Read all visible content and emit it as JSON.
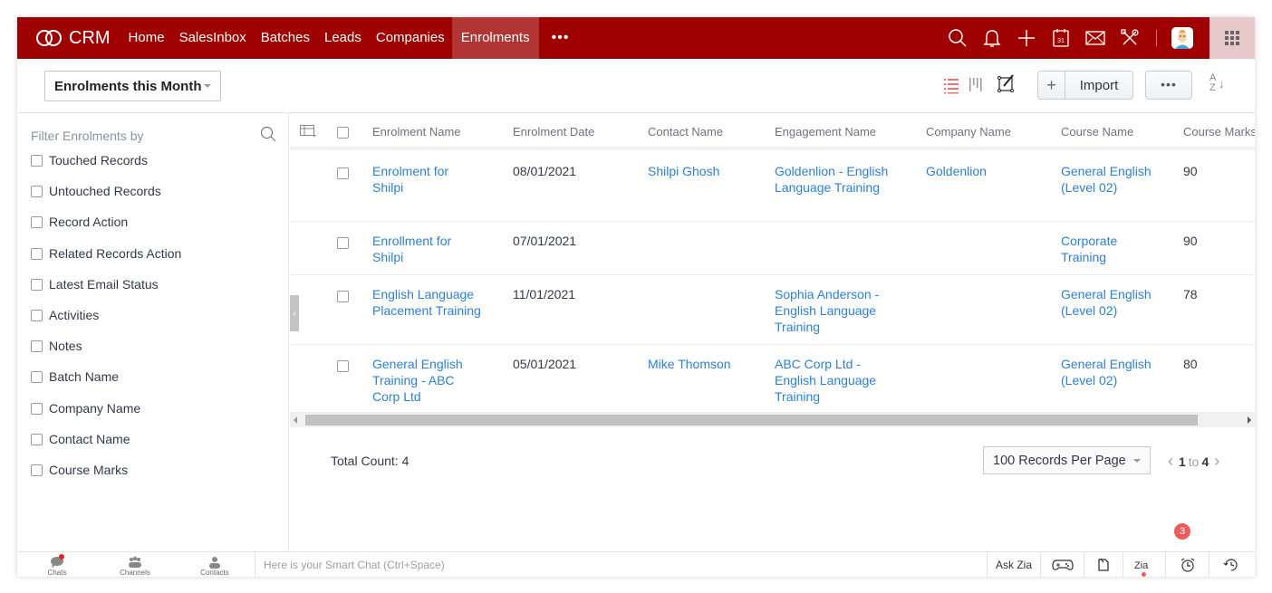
{
  "app": {
    "name": "CRM",
    "brand_color": "#9e0000",
    "active_tab_color": "#b23535",
    "link_color": "#2e7fd3"
  },
  "nav": {
    "items": [
      {
        "label": "Home",
        "active": false
      },
      {
        "label": "SalesInbox",
        "active": false
      },
      {
        "label": "Batches",
        "active": false
      },
      {
        "label": "Leads",
        "active": false
      },
      {
        "label": "Companies",
        "active": false
      },
      {
        "label": "Enrolments",
        "active": true
      }
    ],
    "more_label": "•••",
    "right_icons": [
      "search-icon",
      "bell-icon",
      "plus-icon",
      "calendar-icon",
      "mail-icon",
      "tools-icon",
      "avatar",
      "apps-grid-icon"
    ],
    "calendar_day": "31"
  },
  "toolbar": {
    "view_selected": "Enrolments this Month",
    "view_icons": [
      "list-view-icon",
      "kanban-view-icon",
      "canvas-view-icon"
    ],
    "import_label": "Import",
    "import_plus": "+",
    "more_label": "•••",
    "sort_label_top": "A",
    "sort_label_bottom": "Z",
    "sort_arrow": "↓"
  },
  "sidebar": {
    "title": "Filter Enrolments by",
    "filters": [
      "Touched Records",
      "Untouched Records",
      "Record Action",
      "Related Records Action",
      "Latest Email Status",
      "Activities",
      "Notes",
      "Batch Name",
      "Company Name",
      "Contact Name",
      "Course Marks"
    ]
  },
  "table": {
    "columns": [
      "Enrolment Name",
      "Enrolment Date",
      "Contact Name",
      "Engagement Name",
      "Company Name",
      "Course Name",
      "Course Marks"
    ],
    "rows": [
      {
        "enrolment_name": "Enrolment for Shilpi",
        "enrolment_date": "08/01/2021",
        "contact_name": "Shilpi Ghosh",
        "engagement_name": "Goldenlion - English Language Training",
        "company_name": "Goldenlion",
        "course_name": "General English (Level 02)",
        "course_marks": "90"
      },
      {
        "enrolment_name": "Enrollment for Shilpi",
        "enrolment_date": "07/01/2021",
        "contact_name": "",
        "engagement_name": "",
        "company_name": "",
        "course_name": "Corporate Training",
        "course_marks": "90"
      },
      {
        "enrolment_name": "English Language Placement Training",
        "enrolment_date": "11/01/2021",
        "contact_name": "",
        "engagement_name": "Sophia Anderson - English Language Training",
        "company_name": "",
        "course_name": "General English (Level 02)",
        "course_marks": "78"
      },
      {
        "enrolment_name": "General English Training - ABC Corp Ltd",
        "enrolment_date": "05/01/2021",
        "contact_name": "Mike Thomson",
        "engagement_name": "ABC Corp Ltd - English Language Training",
        "company_name": "",
        "course_name": "General English (Level 02)",
        "course_marks": "80"
      }
    ]
  },
  "footer": {
    "total_count": "Total Count: 4",
    "per_page": "100 Records Per Page",
    "page_from": "1",
    "page_to_word": "to",
    "page_to": "4"
  },
  "bottombar": {
    "tabs": [
      "Chats",
      "Channels",
      "Contacts"
    ],
    "smartchat_placeholder": "Here is your Smart Chat (Ctrl+Space)",
    "ask_zia": "Ask Zia",
    "reminder_badge": "3"
  }
}
